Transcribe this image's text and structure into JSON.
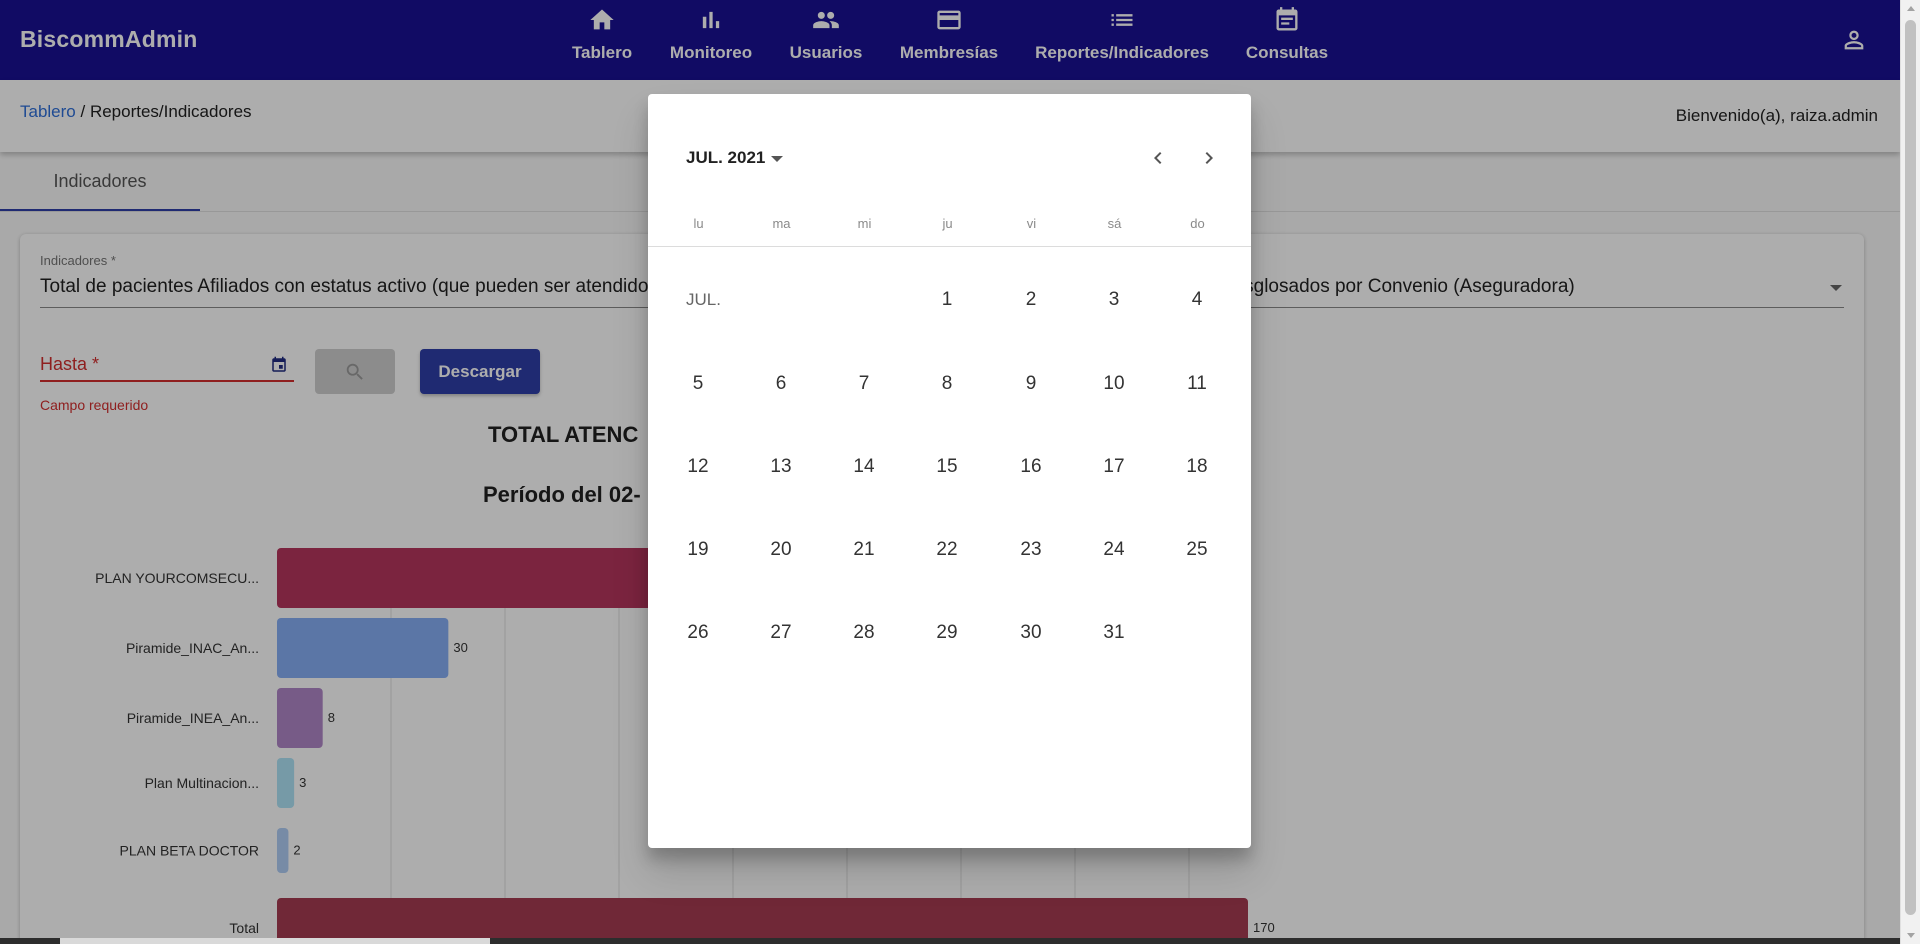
{
  "app": {
    "brand": "BiscommAdmin"
  },
  "nav": [
    {
      "label": "Tablero",
      "icon": "home-icon"
    },
    {
      "label": "Monitoreo",
      "icon": "bar-chart-icon"
    },
    {
      "label": "Usuarios",
      "icon": "people-icon"
    },
    {
      "label": "Membresías",
      "icon": "credit-card-icon"
    },
    {
      "label": "Reportes/Indicadores",
      "icon": "list-icon"
    },
    {
      "label": "Consultas",
      "icon": "calendar-icon"
    }
  ],
  "account": {
    "icon": "person-icon"
  },
  "breadcrumb": {
    "root": "Tablero",
    "separator": " / ",
    "current": "Reportes/Indicadores"
  },
  "welcome": "Bienvenido(a), raiza.admin",
  "tabs": [
    {
      "label": "Indicadores"
    }
  ],
  "filters": {
    "indicador_label": "Indicadores *",
    "indicador_value": "Total de pacientes Afiliados con estatus activo (que pueden ser atendidos) en el período seleccionado en la fecha de la consulta de su Plan, desglosados por Convenio (Aseguradora)",
    "hasta_label": "Hasta *",
    "hasta_error": "Campo requerido",
    "search_icon": "search-icon",
    "download_label": "Descargar"
  },
  "chart_data": {
    "type": "bar",
    "orientation": "horizontal",
    "title": "TOTAL ATENC",
    "subtitle": "Período del 02-",
    "categories": [
      "PLAN YOURCOMSECU...",
      "Piramide_INAC_An...",
      "Piramide_INEA_An...",
      "Plan Multinacion...",
      "PLAN BETA DOCTOR",
      "Total"
    ],
    "values": [
      127,
      30,
      8,
      3,
      2,
      170
    ],
    "data_labels": [
      "",
      "30",
      "8",
      "3",
      "2",
      "170"
    ],
    "colors": [
      "#b6355d",
      "#87aef5",
      "#b086c8",
      "#aee3f7",
      "#b0cdf5",
      "#a63b52"
    ],
    "xlim": [
      0,
      170
    ],
    "grid": true
  },
  "datepicker": {
    "period": "JUL. 2021",
    "month_label": "JUL.",
    "weekdays": [
      "lu",
      "ma",
      "mi",
      "ju",
      "vi",
      "sá",
      "do"
    ],
    "first_weekday_index": 3,
    "days_in_month": 31,
    "prev_icon": "chevron-left-icon",
    "next_icon": "chevron-right-icon"
  }
}
